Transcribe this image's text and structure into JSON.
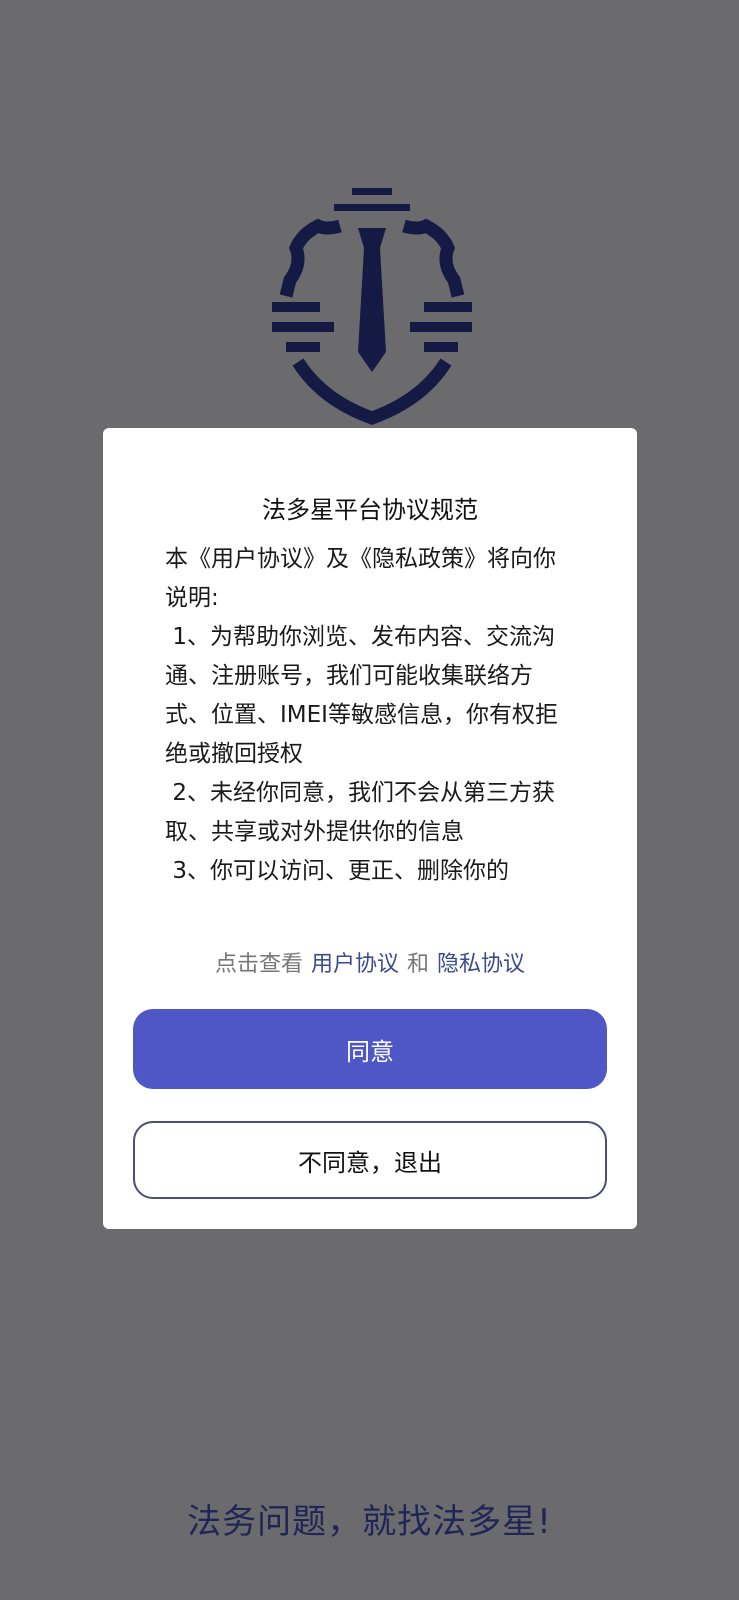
{
  "background": {
    "color": "#6b6b6d",
    "logo_icon": "shield-necktie-icon",
    "logo_color": "#141a44",
    "slogan": "法务问题，就找法多星!"
  },
  "dialog": {
    "title": "法多星平台协议规范",
    "content": "本《用户协议》及《隐私政策》将向你说明:\n 1、为帮助你浏览、发布内容、交流沟通、注册账号，我们可能收集联络方式、位置、IMEI等敏感信息，你有权拒绝或撤回授权\n 2、未经你同意，我们不会从第三方获取、共享或对外提供你的信息\n 3、你可以访问、更正、删除你的",
    "links": {
      "prefix": "点击查看",
      "user_agreement": "用户协议",
      "and": "和",
      "privacy_agreement": "隐私协议"
    },
    "agree_label": "同意",
    "disagree_label": "不同意，退出",
    "accent_color": "#4f57c6",
    "link_color": "#3d4a8e"
  }
}
